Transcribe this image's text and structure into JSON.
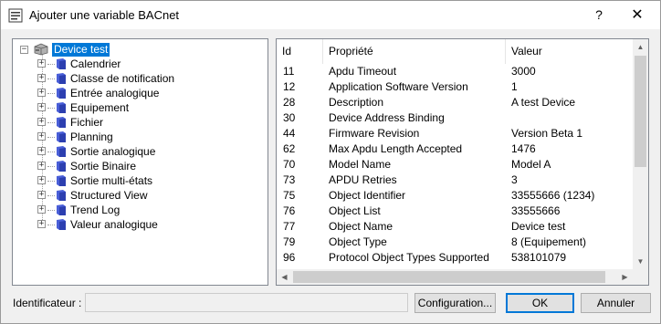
{
  "window": {
    "title": "Ajouter une variable BACnet",
    "help_label": "?",
    "close_label": "✕"
  },
  "tree": {
    "root": {
      "label": "Device test",
      "expander": "−"
    },
    "items": [
      {
        "label": "Calendrier",
        "expander": "+"
      },
      {
        "label": "Classe de notification",
        "expander": "+"
      },
      {
        "label": "Entrée analogique",
        "expander": "+"
      },
      {
        "label": "Equipement",
        "expander": "+"
      },
      {
        "label": "Fichier",
        "expander": "+"
      },
      {
        "label": "Planning",
        "expander": "+"
      },
      {
        "label": "Sortie analogique",
        "expander": "+"
      },
      {
        "label": "Sortie Binaire",
        "expander": "+"
      },
      {
        "label": "Sortie multi-états",
        "expander": "+"
      },
      {
        "label": "Structured View",
        "expander": "+"
      },
      {
        "label": "Trend Log",
        "expander": "+"
      },
      {
        "label": "Valeur analogique",
        "expander": "+"
      }
    ]
  },
  "properties": {
    "headers": {
      "id": "Id",
      "property": "Propriété",
      "value": "Valeur"
    },
    "rows": [
      {
        "id": "11",
        "property": "Apdu Timeout",
        "value": "3000"
      },
      {
        "id": "12",
        "property": "Application Software Version",
        "value": "1"
      },
      {
        "id": "28",
        "property": "Description",
        "value": "A test Device"
      },
      {
        "id": "30",
        "property": "Device Address Binding",
        "value": ""
      },
      {
        "id": "44",
        "property": "Firmware Revision",
        "value": "Version Beta 1"
      },
      {
        "id": "62",
        "property": "Max Apdu Length Accepted",
        "value": "1476"
      },
      {
        "id": "70",
        "property": "Model Name",
        "value": "Model A"
      },
      {
        "id": "73",
        "property": "APDU Retries",
        "value": "3"
      },
      {
        "id": "75",
        "property": "Object Identifier",
        "value": "33555666 (1234)"
      },
      {
        "id": "76",
        "property": "Object List",
        "value": "33555666"
      },
      {
        "id": "77",
        "property": "Object Name",
        "value": "Device test"
      },
      {
        "id": "79",
        "property": "Object Type",
        "value": "8 (Equipement)"
      },
      {
        "id": "96",
        "property": "Protocol Object Types Supported",
        "value": "538101079"
      }
    ],
    "scroll_up": "▲",
    "scroll_down": "▼",
    "scroll_left": "◀",
    "scroll_right": "▶"
  },
  "footer": {
    "identifier_label": "Identificateur :",
    "identifier_value": "",
    "config_button": "Configuration...",
    "ok_button": "OK",
    "cancel_button": "Annuler"
  },
  "colors": {
    "selection": "#0078d7",
    "folder": "#4a5fd8"
  }
}
